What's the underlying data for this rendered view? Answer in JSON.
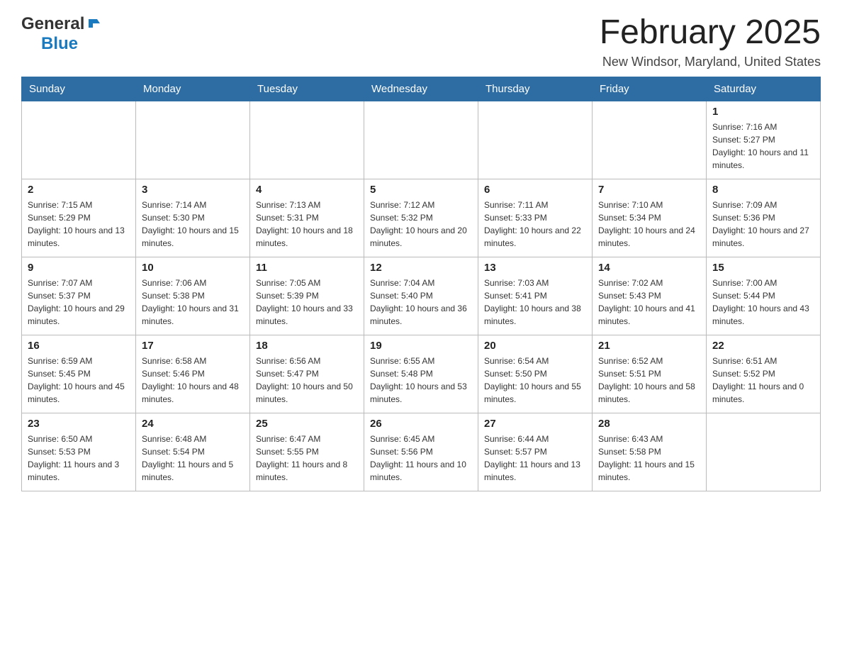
{
  "header": {
    "logo_general": "General",
    "logo_blue": "Blue",
    "title": "February 2025",
    "location": "New Windsor, Maryland, United States"
  },
  "calendar": {
    "days_of_week": [
      "Sunday",
      "Monday",
      "Tuesday",
      "Wednesday",
      "Thursday",
      "Friday",
      "Saturday"
    ],
    "weeks": [
      {
        "days": [
          {
            "number": "",
            "sunrise": "",
            "sunset": "",
            "daylight": "",
            "empty": true
          },
          {
            "number": "",
            "sunrise": "",
            "sunset": "",
            "daylight": "",
            "empty": true
          },
          {
            "number": "",
            "sunrise": "",
            "sunset": "",
            "daylight": "",
            "empty": true
          },
          {
            "number": "",
            "sunrise": "",
            "sunset": "",
            "daylight": "",
            "empty": true
          },
          {
            "number": "",
            "sunrise": "",
            "sunset": "",
            "daylight": "",
            "empty": true
          },
          {
            "number": "",
            "sunrise": "",
            "sunset": "",
            "daylight": "",
            "empty": true
          },
          {
            "number": "1",
            "sunrise": "Sunrise: 7:16 AM",
            "sunset": "Sunset: 5:27 PM",
            "daylight": "Daylight: 10 hours and 11 minutes.",
            "empty": false
          }
        ]
      },
      {
        "days": [
          {
            "number": "2",
            "sunrise": "Sunrise: 7:15 AM",
            "sunset": "Sunset: 5:29 PM",
            "daylight": "Daylight: 10 hours and 13 minutes.",
            "empty": false
          },
          {
            "number": "3",
            "sunrise": "Sunrise: 7:14 AM",
            "sunset": "Sunset: 5:30 PM",
            "daylight": "Daylight: 10 hours and 15 minutes.",
            "empty": false
          },
          {
            "number": "4",
            "sunrise": "Sunrise: 7:13 AM",
            "sunset": "Sunset: 5:31 PM",
            "daylight": "Daylight: 10 hours and 18 minutes.",
            "empty": false
          },
          {
            "number": "5",
            "sunrise": "Sunrise: 7:12 AM",
            "sunset": "Sunset: 5:32 PM",
            "daylight": "Daylight: 10 hours and 20 minutes.",
            "empty": false
          },
          {
            "number": "6",
            "sunrise": "Sunrise: 7:11 AM",
            "sunset": "Sunset: 5:33 PM",
            "daylight": "Daylight: 10 hours and 22 minutes.",
            "empty": false
          },
          {
            "number": "7",
            "sunrise": "Sunrise: 7:10 AM",
            "sunset": "Sunset: 5:34 PM",
            "daylight": "Daylight: 10 hours and 24 minutes.",
            "empty": false
          },
          {
            "number": "8",
            "sunrise": "Sunrise: 7:09 AM",
            "sunset": "Sunset: 5:36 PM",
            "daylight": "Daylight: 10 hours and 27 minutes.",
            "empty": false
          }
        ]
      },
      {
        "days": [
          {
            "number": "9",
            "sunrise": "Sunrise: 7:07 AM",
            "sunset": "Sunset: 5:37 PM",
            "daylight": "Daylight: 10 hours and 29 minutes.",
            "empty": false
          },
          {
            "number": "10",
            "sunrise": "Sunrise: 7:06 AM",
            "sunset": "Sunset: 5:38 PM",
            "daylight": "Daylight: 10 hours and 31 minutes.",
            "empty": false
          },
          {
            "number": "11",
            "sunrise": "Sunrise: 7:05 AM",
            "sunset": "Sunset: 5:39 PM",
            "daylight": "Daylight: 10 hours and 33 minutes.",
            "empty": false
          },
          {
            "number": "12",
            "sunrise": "Sunrise: 7:04 AM",
            "sunset": "Sunset: 5:40 PM",
            "daylight": "Daylight: 10 hours and 36 minutes.",
            "empty": false
          },
          {
            "number": "13",
            "sunrise": "Sunrise: 7:03 AM",
            "sunset": "Sunset: 5:41 PM",
            "daylight": "Daylight: 10 hours and 38 minutes.",
            "empty": false
          },
          {
            "number": "14",
            "sunrise": "Sunrise: 7:02 AM",
            "sunset": "Sunset: 5:43 PM",
            "daylight": "Daylight: 10 hours and 41 minutes.",
            "empty": false
          },
          {
            "number": "15",
            "sunrise": "Sunrise: 7:00 AM",
            "sunset": "Sunset: 5:44 PM",
            "daylight": "Daylight: 10 hours and 43 minutes.",
            "empty": false
          }
        ]
      },
      {
        "days": [
          {
            "number": "16",
            "sunrise": "Sunrise: 6:59 AM",
            "sunset": "Sunset: 5:45 PM",
            "daylight": "Daylight: 10 hours and 45 minutes.",
            "empty": false
          },
          {
            "number": "17",
            "sunrise": "Sunrise: 6:58 AM",
            "sunset": "Sunset: 5:46 PM",
            "daylight": "Daylight: 10 hours and 48 minutes.",
            "empty": false
          },
          {
            "number": "18",
            "sunrise": "Sunrise: 6:56 AM",
            "sunset": "Sunset: 5:47 PM",
            "daylight": "Daylight: 10 hours and 50 minutes.",
            "empty": false
          },
          {
            "number": "19",
            "sunrise": "Sunrise: 6:55 AM",
            "sunset": "Sunset: 5:48 PM",
            "daylight": "Daylight: 10 hours and 53 minutes.",
            "empty": false
          },
          {
            "number": "20",
            "sunrise": "Sunrise: 6:54 AM",
            "sunset": "Sunset: 5:50 PM",
            "daylight": "Daylight: 10 hours and 55 minutes.",
            "empty": false
          },
          {
            "number": "21",
            "sunrise": "Sunrise: 6:52 AM",
            "sunset": "Sunset: 5:51 PM",
            "daylight": "Daylight: 10 hours and 58 minutes.",
            "empty": false
          },
          {
            "number": "22",
            "sunrise": "Sunrise: 6:51 AM",
            "sunset": "Sunset: 5:52 PM",
            "daylight": "Daylight: 11 hours and 0 minutes.",
            "empty": false
          }
        ]
      },
      {
        "days": [
          {
            "number": "23",
            "sunrise": "Sunrise: 6:50 AM",
            "sunset": "Sunset: 5:53 PM",
            "daylight": "Daylight: 11 hours and 3 minutes.",
            "empty": false
          },
          {
            "number": "24",
            "sunrise": "Sunrise: 6:48 AM",
            "sunset": "Sunset: 5:54 PM",
            "daylight": "Daylight: 11 hours and 5 minutes.",
            "empty": false
          },
          {
            "number": "25",
            "sunrise": "Sunrise: 6:47 AM",
            "sunset": "Sunset: 5:55 PM",
            "daylight": "Daylight: 11 hours and 8 minutes.",
            "empty": false
          },
          {
            "number": "26",
            "sunrise": "Sunrise: 6:45 AM",
            "sunset": "Sunset: 5:56 PM",
            "daylight": "Daylight: 11 hours and 10 minutes.",
            "empty": false
          },
          {
            "number": "27",
            "sunrise": "Sunrise: 6:44 AM",
            "sunset": "Sunset: 5:57 PM",
            "daylight": "Daylight: 11 hours and 13 minutes.",
            "empty": false
          },
          {
            "number": "28",
            "sunrise": "Sunrise: 6:43 AM",
            "sunset": "Sunset: 5:58 PM",
            "daylight": "Daylight: 11 hours and 15 minutes.",
            "empty": false
          },
          {
            "number": "",
            "sunrise": "",
            "sunset": "",
            "daylight": "",
            "empty": true
          }
        ]
      }
    ]
  }
}
